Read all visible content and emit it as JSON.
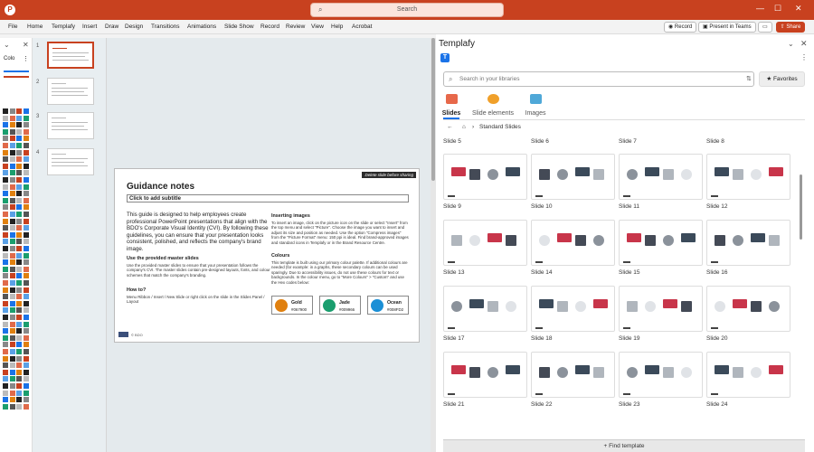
{
  "titlebar": {
    "search_placeholder": "Search"
  },
  "ribbon": {
    "menu": [
      "File",
      "Home",
      "Templafy",
      "Insert",
      "Draw",
      "Design",
      "Transitions",
      "Animations",
      "Slide Show",
      "Record",
      "Review",
      "View",
      "Help",
      "Acrobat"
    ],
    "record_label": "Record",
    "teams_label": "Present in Teams",
    "share_label": "Share"
  },
  "left_panel": {
    "color_label": "Colo"
  },
  "thumbnails": [
    "1",
    "2",
    "3",
    "4"
  ],
  "slide": {
    "delete_tag": "Delete slide before sharing",
    "title": "Guidance notes",
    "subtitle": "Click to add subtitle",
    "intro": "This guide is designed to help employees create professional PowerPoint presentations that align with the BDO's Corporate Visual Identity (CVI). By following these guidelines, you can ensure that your presentation looks consistent, polished, and reflects the company's brand image.",
    "use_heading": "Use the provided master slides",
    "use_text": "Use the provided master slides to ensure that your presentation follows the company's CVI. The master slides contain pre-designed layouts, fonts, and colour schemes that match the company's branding.",
    "how_heading": "How to?",
    "how_text": "Menu Ribbon / Insert / New Slide or right click on the slide in the Slides Panel / Layout",
    "images_heading": "Inserting images",
    "images_text": "To insert an image, click on the picture icon on the slide or select \"Insert\" from the top menu and select \"Picture\". Choose the image you want to insert and adjust its size and position as needed. Use the option \"Compress images\" from the \"Picture Format\" menu: 150 ppi is ideal. Find brand-approved images and standard icons in Templafy or in the Brand Resource Centre.",
    "colours_heading": "Colours",
    "colours_text": "This template is built using our primary colour palette. If additional colours are needed (for example: in a graphs, these secondary colours can be used sparingly. Due to accessibility issues, do not use these colours for text or backgrounds. In the colour menu, go to \"More Colours\" > \"Custom\" and use the Hex codes below:",
    "colours": [
      {
        "name": "Gold",
        "hex": "#067900",
        "color": "#e0800f"
      },
      {
        "name": "Jade",
        "hex": "#009966",
        "color": "#1a9e6e"
      },
      {
        "name": "Ocean",
        "hex": "#008FD2",
        "color": "#1a8fd6"
      }
    ],
    "footer_text": "© BDO"
  },
  "templafy": {
    "title": "Templafy",
    "search_placeholder": "Search in your libraries",
    "favorites_label": "Favorites",
    "tabs": [
      "Slides",
      "Slide elements",
      "Images"
    ],
    "crumb": "Standard Slides",
    "top_labels": [
      "Slide 5",
      "Slide 6",
      "Slide 7",
      "Slide 8"
    ],
    "cards": [
      {
        "label": "Slide 9"
      },
      {
        "label": "Slide 10"
      },
      {
        "label": "Slide 11"
      },
      {
        "label": "Slide 12"
      },
      {
        "label": "Slide 13"
      },
      {
        "label": "Slide 14"
      },
      {
        "label": "Slide 15"
      },
      {
        "label": "Slide 16"
      },
      {
        "label": "Slide 17"
      },
      {
        "label": "Slide 18"
      },
      {
        "label": "Slide 19"
      },
      {
        "label": "Slide 20"
      },
      {
        "label": "Slide 21"
      },
      {
        "label": "Slide 22"
      },
      {
        "label": "Slide 23"
      },
      {
        "label": "Slide 24"
      }
    ],
    "find_template_label": "Find template"
  }
}
